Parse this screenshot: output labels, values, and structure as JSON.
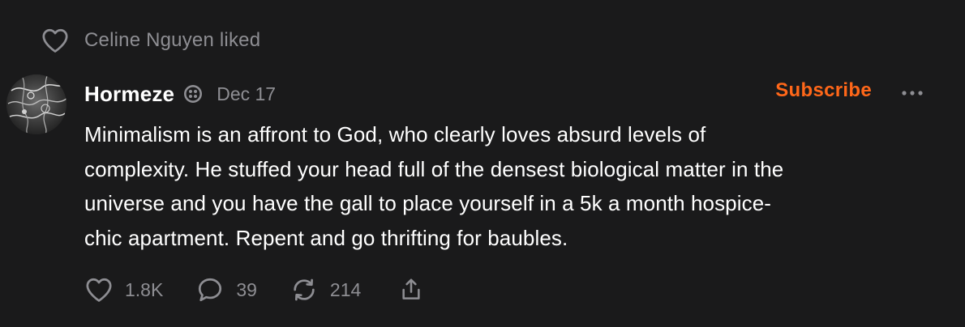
{
  "liked_by": {
    "text": "Celine Nguyen liked",
    "icon": "heart-outline-icon"
  },
  "post": {
    "author": "Hormeze",
    "badge_icon": "subscriber-badge-icon",
    "date": "Dec 17",
    "subscribe_label": "Subscribe",
    "more_icon": "ellipsis-icon",
    "body": "Minimalism is an affront to God, who clearly loves absurd levels of\ncomplexity. He stuffed your head full of the densest biological matter in the\nuniverse and you have the gall to place yourself in a 5k a month hospice-\nchic apartment. Repent and go thrifting for baubles."
  },
  "actions": {
    "likes": "1.8K",
    "comments": "39",
    "restacks": "214"
  },
  "colors": {
    "background": "#1a1a1b",
    "accent": "#ff6719",
    "muted": "#8e8e93",
    "text": "#ffffff"
  }
}
